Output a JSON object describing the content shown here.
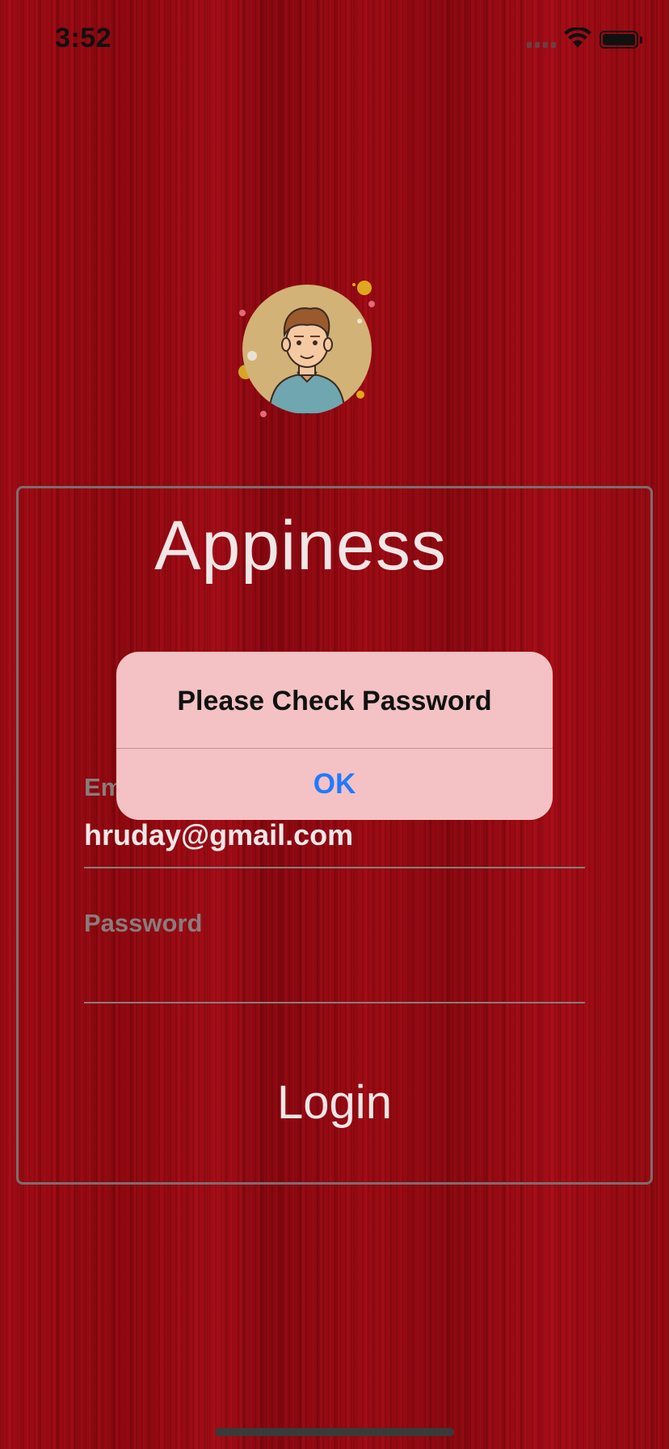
{
  "status_bar": {
    "time": "3:52"
  },
  "app": {
    "title": "Appiness"
  },
  "form": {
    "email_label": "Email",
    "email_value": "hruday@gmail.com",
    "password_label": "Password",
    "login_label": "Login"
  },
  "alert": {
    "title": "Please Check Password",
    "ok_label": "OK"
  },
  "icons": [
    "wifi-icon",
    "battery-icon",
    "signal-icon",
    "avatar-image"
  ],
  "colors": {
    "background": "#9b0a12",
    "alert_bg": "#f4c2c4",
    "alert_button": "#1f7aff"
  }
}
